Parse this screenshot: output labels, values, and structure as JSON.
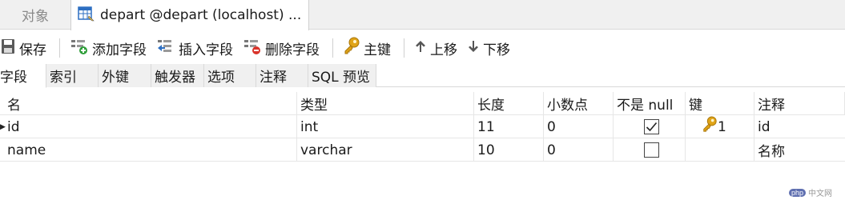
{
  "tabs": {
    "objects_label": "对象",
    "active_label": "depart @depart (localhost) ..."
  },
  "toolbar": {
    "save": "保存",
    "add_field": "添加字段",
    "insert_field": "插入字段",
    "delete_field": "删除字段",
    "primary_key": "主键",
    "move_up": "上移",
    "move_down": "下移"
  },
  "subtabs": [
    "字段",
    "索引",
    "外键",
    "触发器",
    "选项",
    "注释",
    "SQL 预览"
  ],
  "table": {
    "headers": {
      "name": "名",
      "type": "类型",
      "length": "长度",
      "decimals": "小数点",
      "not_null": "不是 null",
      "key": "键",
      "comment": "注释"
    },
    "rows": [
      {
        "name": "id",
        "type": "int",
        "length": "11",
        "decimals": "0",
        "not_null": true,
        "key": "1",
        "comment": "id"
      },
      {
        "name": "name",
        "type": "varchar",
        "length": "10",
        "decimals": "0",
        "not_null": false,
        "key": "",
        "comment": "名称"
      }
    ]
  },
  "watermark": {
    "logo": "php",
    "text": "中文网"
  },
  "colors": {
    "key_gold": "#e0a418",
    "add_green": "#2f9e3a",
    "delete_red": "#d9342b",
    "insert_blue": "#2d6fc2"
  }
}
